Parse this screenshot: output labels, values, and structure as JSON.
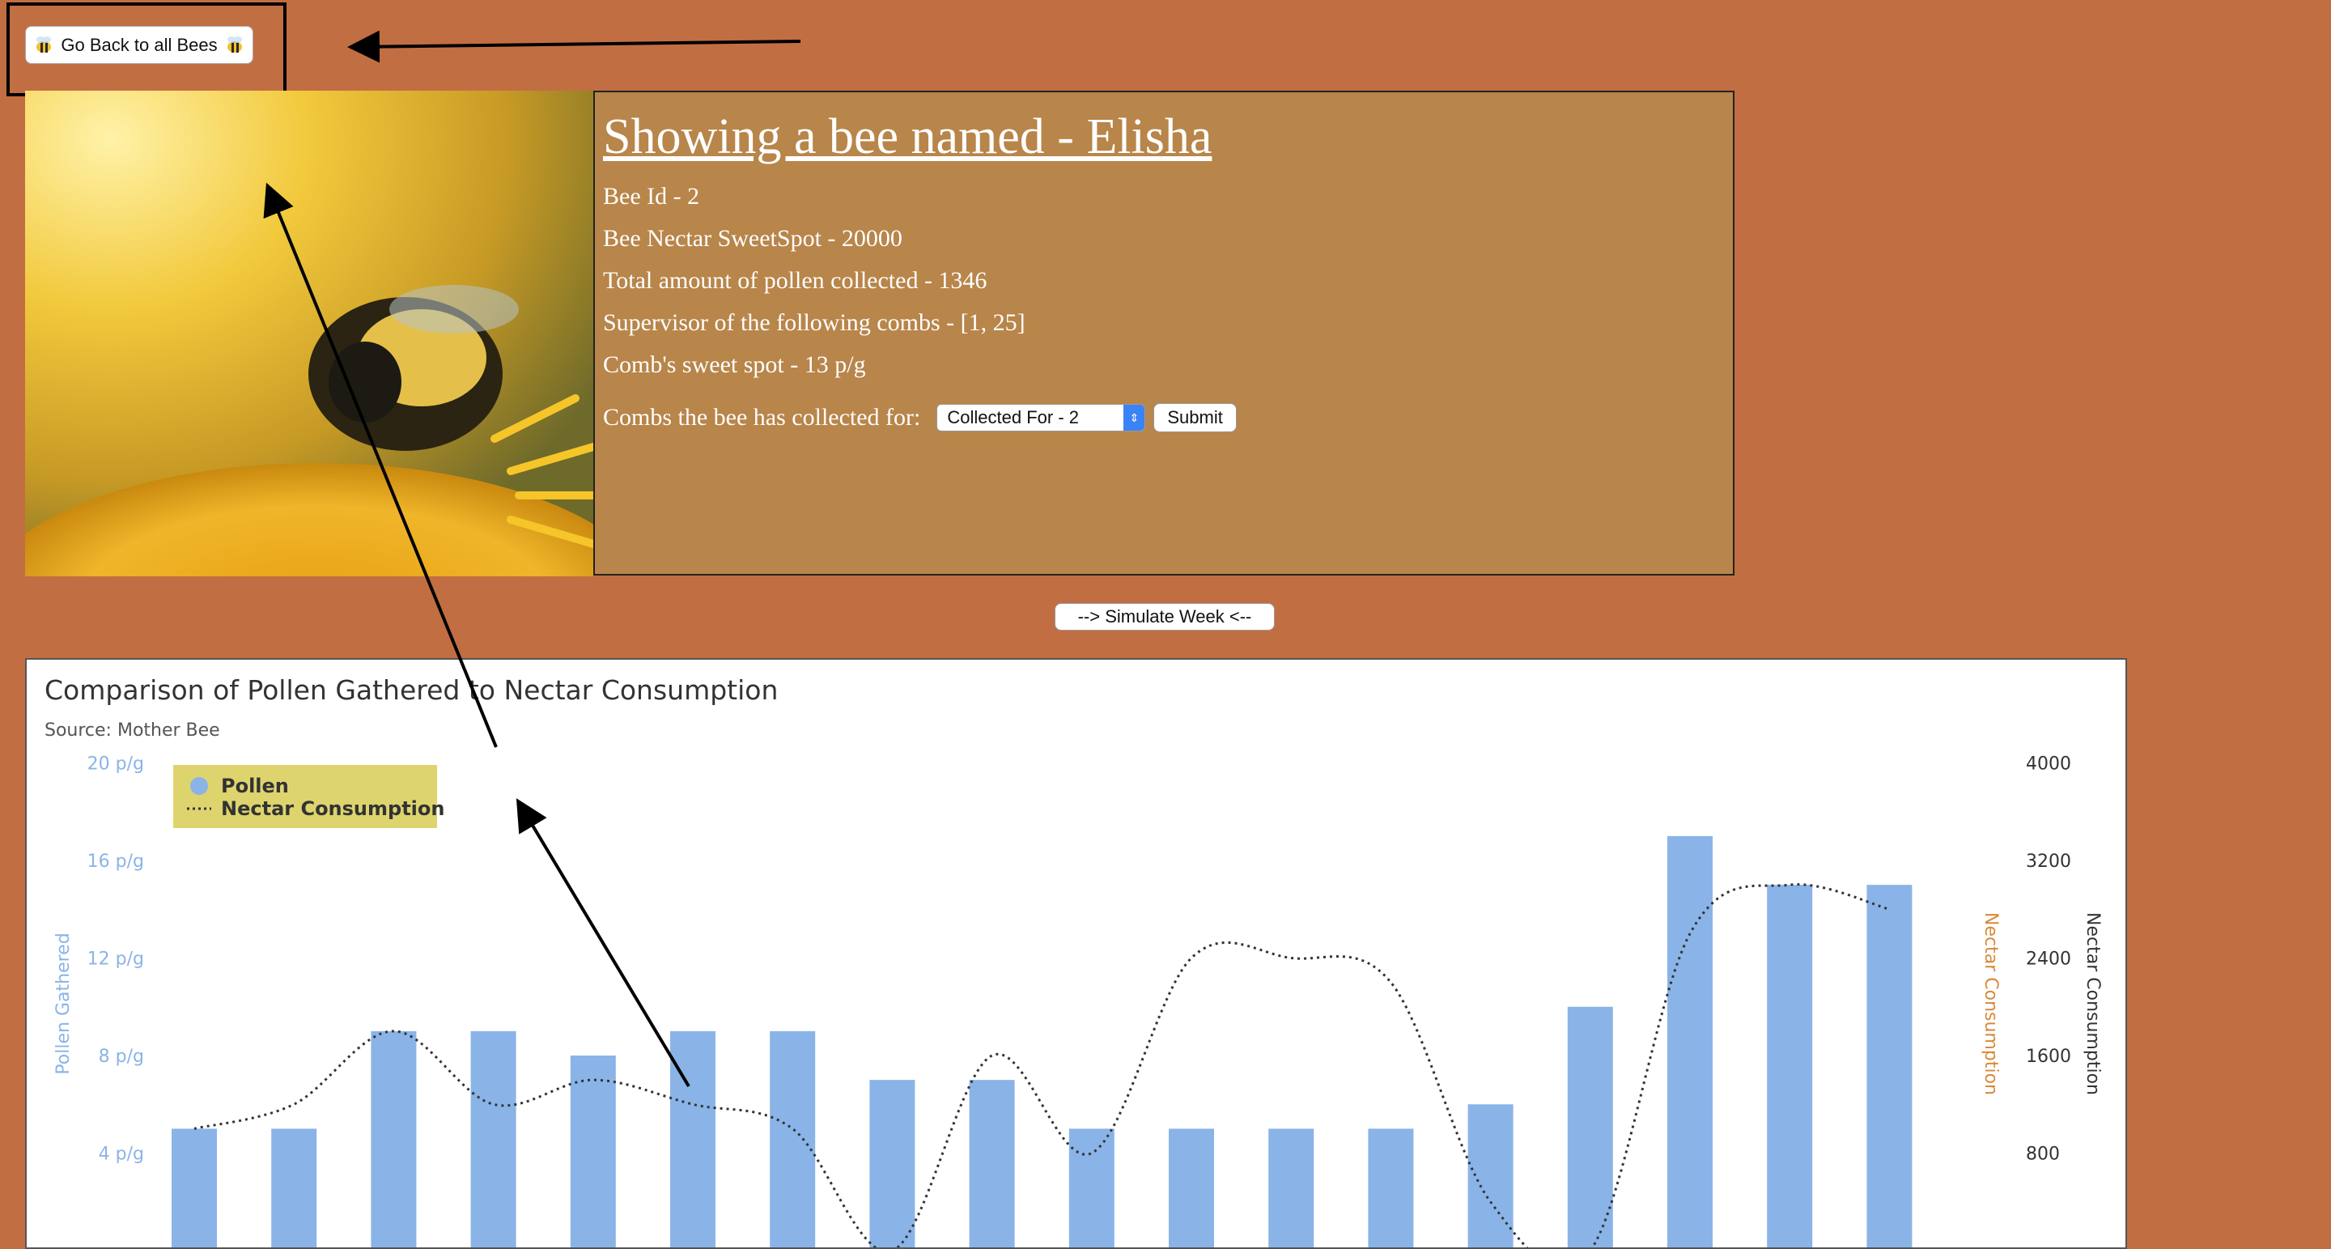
{
  "nav": {
    "back_label": "Go Back to all Bees"
  },
  "bee": {
    "title": "Showing a bee named - Elisha",
    "id_line": "Bee Id - 2",
    "sweetspot_line": "Bee Nectar SweetSpot - 20000",
    "pollen_line": "Total amount of pollen collected - 1346",
    "supervisor_line": "Supervisor of the following combs - [1, 25]",
    "comb_sweetspot_line": "Comb's sweet spot - 13 p/g",
    "combs_label": "Combs the bee has collected for:",
    "combs_selected": "Collected For - 2",
    "submit_label": "Submit"
  },
  "simulate_label": "--> Simulate Week <--",
  "colors": {
    "background": "#c26e43",
    "panel": "#b8854a",
    "bar": "#8ab4e8",
    "nectar_axis": "#d9893a",
    "legend_bg": "#ded46e"
  },
  "chart_data": {
    "type": "bar",
    "title": "Comparison of Pollen Gathered to Nectar Consumption",
    "subtitle": "Source: Mother Bee",
    "ylabel": "Pollen Gathered",
    "ylabel_right_1": "Nectar Consumption",
    "ylabel_right_2": "Nectar Consumption",
    "ylim": [
      0,
      20
    ],
    "y2lim": [
      0,
      4000
    ],
    "yticks": [
      "4 p/g",
      "8 p/g",
      "12 p/g",
      "16 p/g",
      "20 p/g"
    ],
    "y2ticks": [
      "800",
      "1600",
      "2400",
      "3200",
      "4000"
    ],
    "legend": {
      "position": "top-left",
      "entries": [
        "Pollen",
        "Nectar Consumption"
      ]
    },
    "series": [
      {
        "name": "Pollen",
        "type": "bar",
        "values": [
          5,
          5,
          9,
          9,
          8,
          9,
          9,
          7,
          7,
          5,
          5,
          5,
          5,
          6,
          10,
          17,
          15,
          15
        ]
      },
      {
        "name": "Nectar Consumption",
        "type": "spline",
        "values": [
          1000,
          1200,
          1800,
          1200,
          1400,
          1200,
          1000,
          0,
          1600,
          800,
          2400,
          2400,
          2200,
          400,
          0,
          2600,
          3000,
          2800
        ]
      }
    ]
  }
}
